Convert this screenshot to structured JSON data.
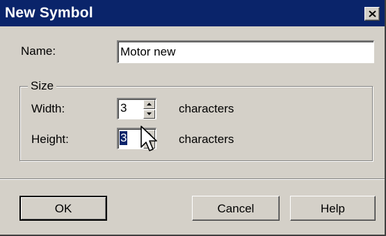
{
  "window": {
    "title": "New Symbol"
  },
  "name_field": {
    "label": "Name:",
    "value": "Motor new"
  },
  "size_group": {
    "title": "Size",
    "width": {
      "label": "Width:",
      "value": "3",
      "unit": "characters"
    },
    "height": {
      "label": "Height:",
      "value": "3",
      "unit": "characters"
    }
  },
  "buttons": {
    "ok": "OK",
    "cancel": "Cancel",
    "help": "Help"
  },
  "icons": {
    "close": "close-icon",
    "spin_up": "up-arrow-icon",
    "spin_down": "down-arrow-icon",
    "cursor": "mouse-pointer-icon"
  },
  "colors": {
    "titlebar": "#0a246a",
    "face": "#d4d0c8",
    "selection": "#0a246a"
  }
}
